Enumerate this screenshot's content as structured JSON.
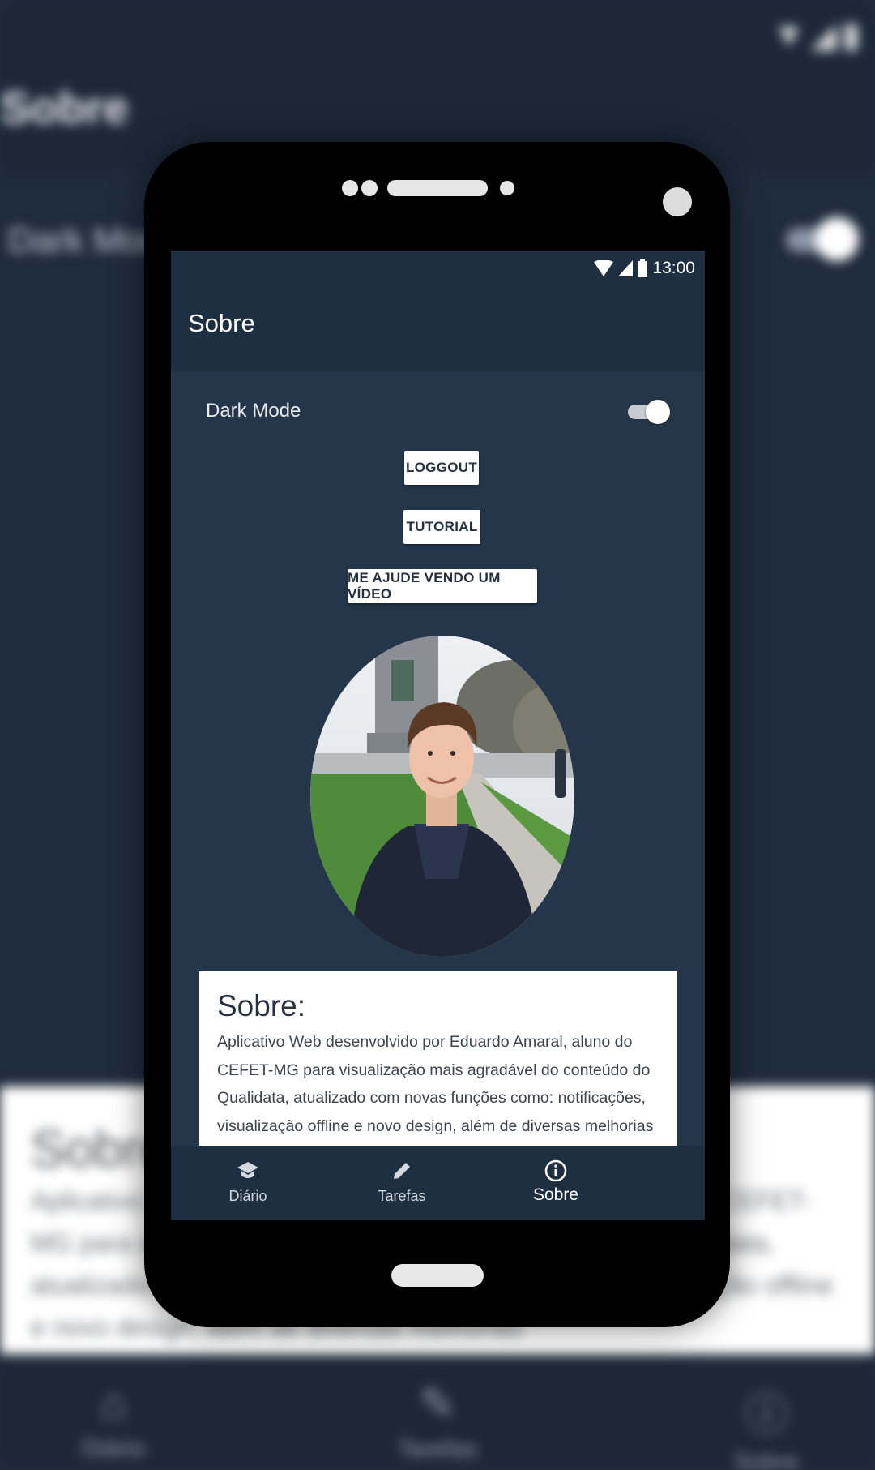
{
  "status": {
    "time": "13:00"
  },
  "appbar": {
    "title": "Sobre"
  },
  "settings": {
    "dark_mode_label": "Dark Mode",
    "dark_mode_on": true
  },
  "buttons": {
    "logout": "LOGGOUT",
    "tutorial": "TUTORIAL",
    "video": "ME AJUDE VENDO UM VÍDEO"
  },
  "about": {
    "title": "Sobre:",
    "text": "Aplicativo Web desenvolvido por Eduardo Amaral, aluno do CEFET-MG para visualização mais agradável do conteúdo do Qualidata, atualizado com novas funções como: notificações, visualização offline e novo design, além de diversas melhorias"
  },
  "nav": {
    "items": [
      {
        "label": "Diário",
        "icon": "school-icon",
        "active": false
      },
      {
        "label": "Tarefas",
        "icon": "pencil-icon",
        "active": false
      },
      {
        "label": "Sobre",
        "icon": "info-icon",
        "active": true
      }
    ]
  },
  "colors": {
    "background": "#1f2c3d",
    "screen": "#25364b",
    "appbar": "#1f2f42",
    "card": "#ffffff"
  }
}
